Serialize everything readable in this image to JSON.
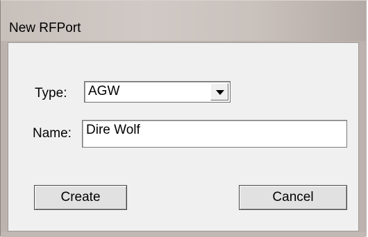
{
  "window": {
    "title": "New RFPort"
  },
  "form": {
    "type_label": "Type:",
    "type_value": "AGW",
    "name_label": "Name:",
    "name_value": "Dire Wolf"
  },
  "buttons": {
    "create_label": "Create",
    "cancel_label": "Cancel"
  },
  "icons": {
    "dropdown": "chevron-down-icon"
  },
  "colors": {
    "title_bar": "#d0c9c5",
    "client_background": "#f0f0f0",
    "button_face": "#e1e1e1"
  }
}
